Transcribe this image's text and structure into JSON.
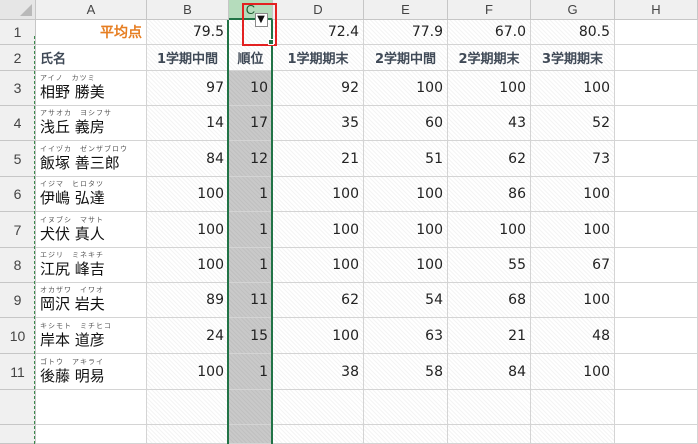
{
  "column_headers": [
    "A",
    "B",
    "C",
    "D",
    "E",
    "F",
    "G",
    "H"
  ],
  "selected_column": "C",
  "row_numbers": [
    "1",
    "2",
    "3",
    "4",
    "5",
    "6",
    "7",
    "8",
    "9",
    "10",
    "11"
  ],
  "row1": {
    "label": "平均点",
    "B": "79.5",
    "C": "",
    "D": "72.4",
    "E": "77.9",
    "F": "67.0",
    "G": "80.5"
  },
  "row2": {
    "A": "氏名",
    "B": "1学期中間",
    "C": "順位",
    "D": "1学期期末",
    "E": "2学期中間",
    "F": "2学期期末",
    "G": "3学期期末"
  },
  "students": [
    {
      "furigana": "アイノ　カツミ",
      "name": "相野 勝美",
      "B": "97",
      "C": "10",
      "D": "92",
      "E": "100",
      "F": "100",
      "G": "100"
    },
    {
      "furigana": "アサオカ　ヨシフサ",
      "name": "浅丘 義房",
      "B": "14",
      "C": "17",
      "D": "35",
      "E": "60",
      "F": "43",
      "G": "52"
    },
    {
      "furigana": "イイヅカ　ゼンザブロウ",
      "name": "飯塚 善三郎",
      "B": "84",
      "C": "12",
      "D": "21",
      "E": "51",
      "F": "62",
      "G": "73"
    },
    {
      "furigana": "イジマ　ヒロタツ",
      "name": "伊嶋 弘達",
      "B": "100",
      "C": "1",
      "D": "100",
      "E": "100",
      "F": "86",
      "G": "100"
    },
    {
      "furigana": "イヌブシ　マサト",
      "name": "犬伏 真人",
      "B": "100",
      "C": "1",
      "D": "100",
      "E": "100",
      "F": "100",
      "G": "100"
    },
    {
      "furigana": "エジリ　ミネキチ",
      "name": "江尻 峰吉",
      "B": "100",
      "C": "1",
      "D": "100",
      "E": "100",
      "F": "55",
      "G": "67"
    },
    {
      "furigana": "オカザワ　イワオ",
      "name": "岡沢 岩夫",
      "B": "89",
      "C": "11",
      "D": "62",
      "E": "54",
      "F": "68",
      "G": "100"
    },
    {
      "furigana": "キシモト　ミチヒコ",
      "name": "岸本 道彦",
      "B": "24",
      "C": "15",
      "D": "100",
      "E": "63",
      "F": "21",
      "G": "48"
    },
    {
      "furigana": "ゴトウ　アキライ",
      "name": "後藤 明易",
      "B": "100",
      "C": "1",
      "D": "38",
      "E": "58",
      "F": "84",
      "G": "100"
    }
  ],
  "sort_button_icon": "sort-down-arrow-icon",
  "colors": {
    "accent_green": "#217346",
    "header_selected": "#b5dcbc",
    "selection_column_fill": "#c9c9c9",
    "highlight_box": "#e32121",
    "average_label": "#e67e22"
  }
}
